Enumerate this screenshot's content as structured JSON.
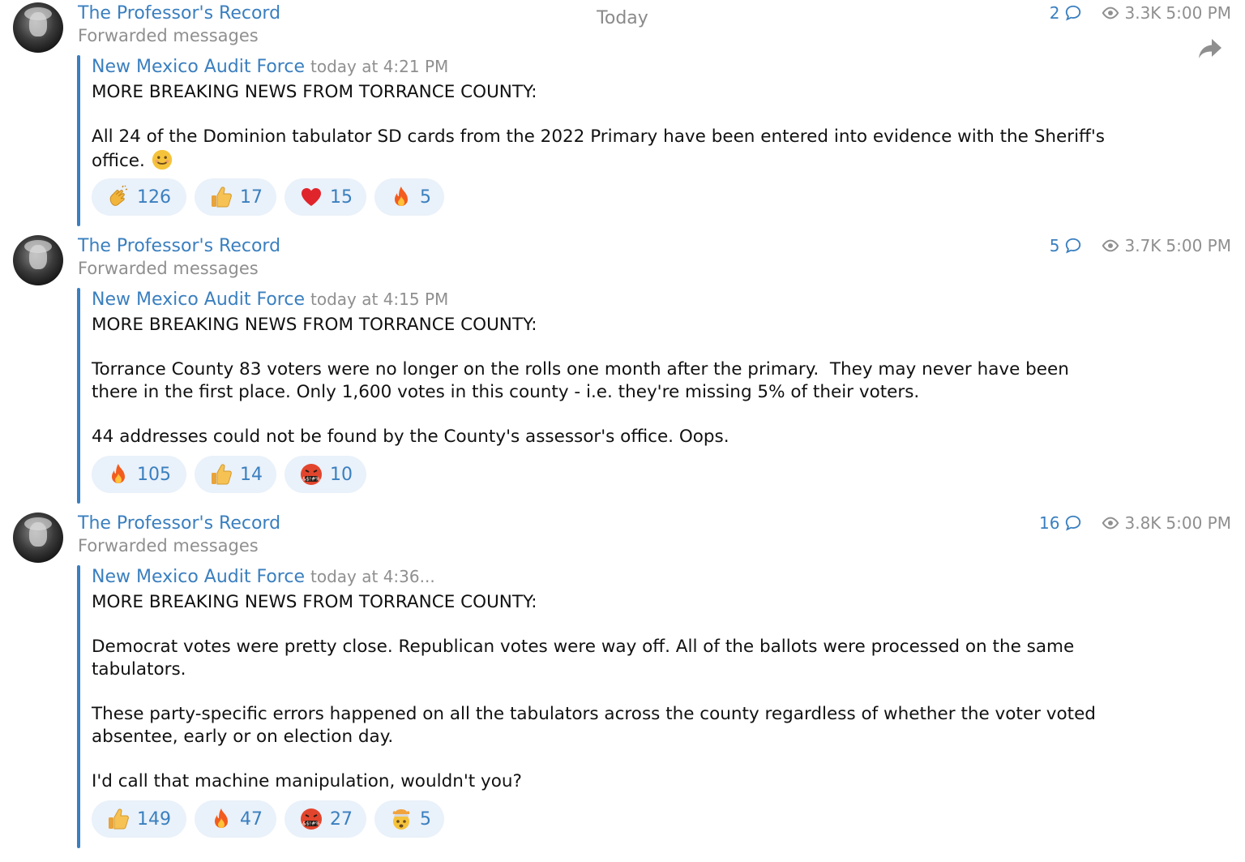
{
  "date_separator": "Today",
  "messages": [
    {
      "channel": "The Professor's Record",
      "forward_label": "Forwarded messages",
      "comments": "2",
      "views": "3.3K",
      "time": "5:00 PM",
      "source": "New Mexico Audit Force",
      "source_time": "today at 4:21 PM",
      "text": "MORE BREAKING NEWS FROM TORRANCE COUNTY:\n\nAll 24 of the Dominion tabulator SD cards from the 2022 Primary have been entered into evidence with the Sheriff's office.",
      "reactions": [
        {
          "emoji": "clapping-hands",
          "count": "126"
        },
        {
          "emoji": "thumbs-up",
          "count": "17"
        },
        {
          "emoji": "red-heart",
          "count": "15"
        },
        {
          "emoji": "fire",
          "count": "5"
        }
      ]
    },
    {
      "channel": "The Professor's Record",
      "forward_label": "Forwarded messages",
      "comments": "5",
      "views": "3.7K",
      "time": "5:00 PM",
      "source": "New Mexico Audit Force",
      "source_time": "today at 4:15 PM",
      "text": "MORE BREAKING NEWS FROM TORRANCE COUNTY:\n\nTorrance County 83 voters were no longer on the rolls one month after the primary.  They may never have been there in the first place. Only 1,600 votes in this county - i.e. they're missing 5% of their voters.\n\n44 addresses could not be found by the County's assessor's office. Oops.",
      "reactions": [
        {
          "emoji": "fire",
          "count": "105"
        },
        {
          "emoji": "thumbs-up",
          "count": "14"
        },
        {
          "emoji": "face-with-symbols",
          "count": "10"
        }
      ]
    },
    {
      "channel": "The Professor's Record",
      "forward_label": "Forwarded messages",
      "comments": "16",
      "views": "3.8K",
      "time": "5:00 PM",
      "source": "New Mexico Audit Force",
      "source_time": "today at 4:36...",
      "text": "MORE BREAKING NEWS FROM TORRANCE COUNTY:\n\nDemocrat votes were pretty close. Republican votes were way off. All of the ballots were processed on the same tabulators.\n\nThese party-specific errors happened on all the tabulators across the county regardless of whether the voter voted absentee, early or on election day.\n\nI'd call that machine manipulation, wouldn't you?",
      "reactions": [
        {
          "emoji": "thumbs-up",
          "count": "149"
        },
        {
          "emoji": "fire",
          "count": "47"
        },
        {
          "emoji": "face-with-symbols",
          "count": "27"
        },
        {
          "emoji": "exploding-head",
          "count": "5"
        }
      ]
    }
  ]
}
